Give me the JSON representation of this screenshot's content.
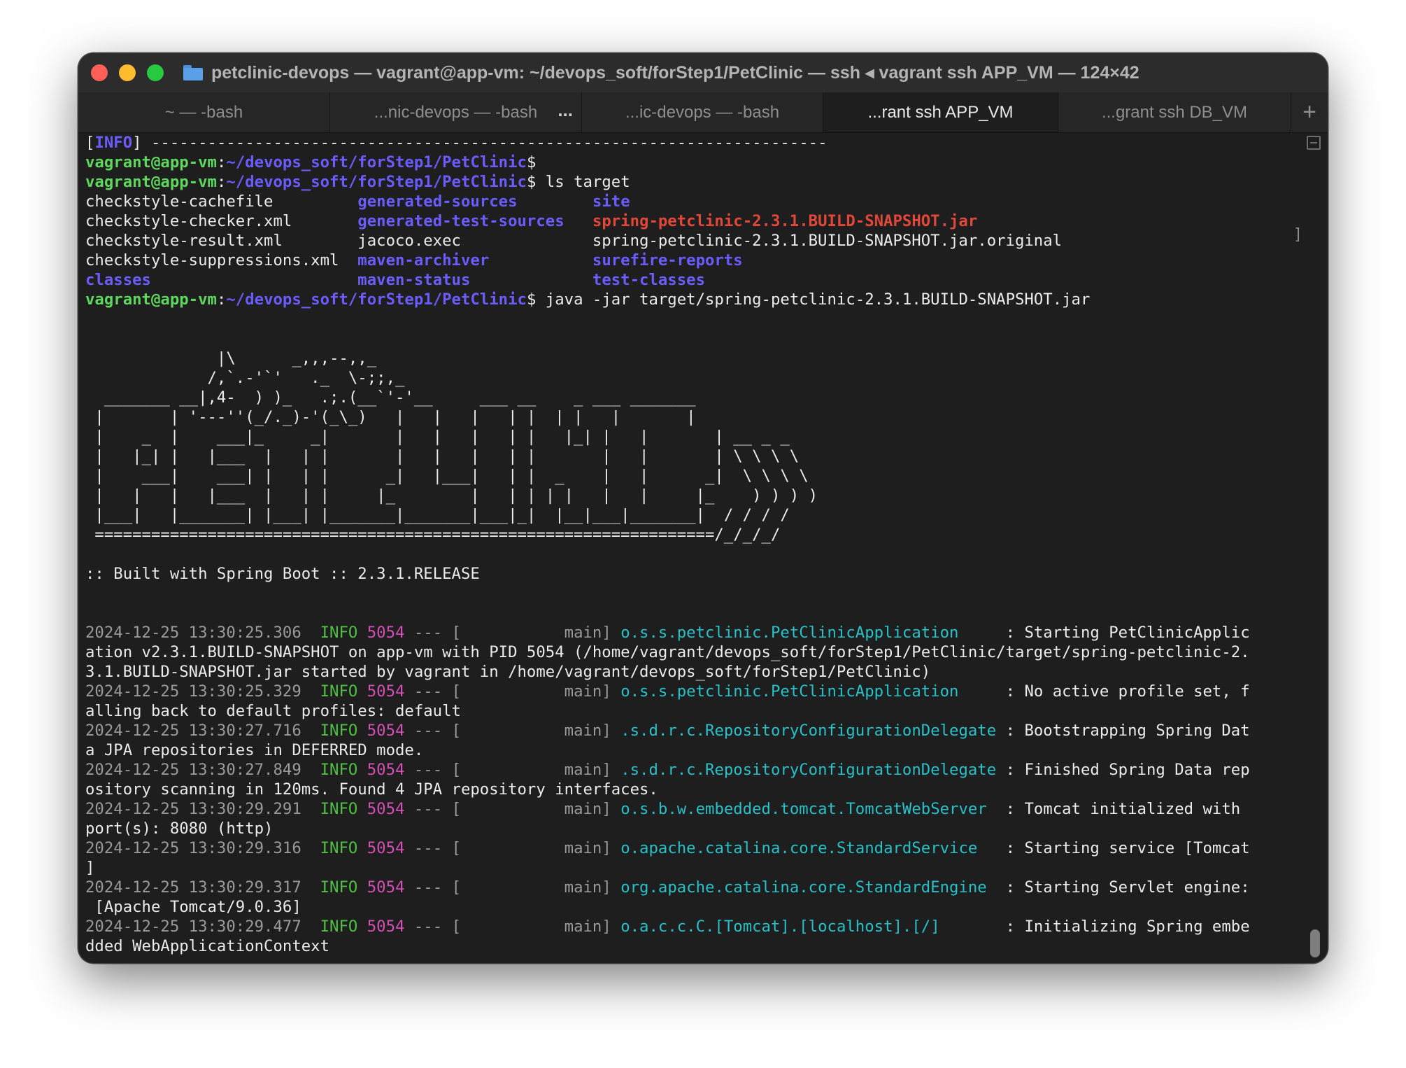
{
  "window": {
    "title": "petclinic-devops — vagrant@app-vm: ~/devops_soft/forStep1/PetClinic — ssh ◂ vagrant ssh APP_VM — 124×42",
    "folder_icon": "folder-icon"
  },
  "tabs": [
    {
      "label": "~ — -bash",
      "active": false,
      "width": 360
    },
    {
      "label": "...nic-devops — -bash",
      "active": false,
      "width": 360,
      "dots": "..."
    },
    {
      "label": "...ic-devops — -bash",
      "active": false,
      "width": 345
    },
    {
      "label": "...rant ssh APP_VM",
      "active": true,
      "width": 336
    },
    {
      "label": "...grant ssh DB_VM",
      "active": false,
      "width": 333
    }
  ],
  "new_tab_label": "+",
  "colors": {
    "prompt_user": "#5fd75f",
    "prompt_path": "#6a5cff",
    "directory": "#6a5cff",
    "archive": "#e2483a",
    "log_info": "#4fbf43",
    "log_pid": "#d44fb6",
    "log_logger": "#27c1c9",
    "log_timestamp": "#9a9a9a"
  },
  "terminal": {
    "lines": [
      [
        {
          "t": "[",
          "c": "white"
        },
        {
          "t": "INFO",
          "c": "purple"
        },
        {
          "t": "] ------------------------------------------------------------------------",
          "c": "white"
        }
      ],
      [
        {
          "t": "vagrant@app-vm",
          "c": "green"
        },
        {
          "t": ":",
          "c": "white"
        },
        {
          "t": "~/devops_soft/forStep1/PetClinic",
          "c": "purple"
        },
        {
          "t": "$",
          "c": "white"
        }
      ],
      [
        {
          "t": "vagrant@app-vm",
          "c": "green"
        },
        {
          "t": ":",
          "c": "white"
        },
        {
          "t": "~/devops_soft/forStep1/PetClinic",
          "c": "purple"
        },
        {
          "t": "$ ls target",
          "c": "white"
        }
      ],
      [
        {
          "t": "checkstyle-cachefile         ",
          "c": "white"
        },
        {
          "t": "generated-sources",
          "c": "purple"
        },
        {
          "t": "        ",
          "c": "white"
        },
        {
          "t": "site",
          "c": "purple"
        }
      ],
      [
        {
          "t": "checkstyle-checker.xml       ",
          "c": "white"
        },
        {
          "t": "generated-test-sources",
          "c": "purple"
        },
        {
          "t": "   ",
          "c": "white"
        },
        {
          "t": "spring-petclinic-2.3.1.BUILD-SNAPSHOT.jar",
          "c": "red"
        }
      ],
      [
        {
          "t": "checkstyle-result.xml        jacoco.exec              spring-petclinic-2.3.1.BUILD-SNAPSHOT.jar.original",
          "c": "white"
        }
      ],
      [
        {
          "t": "checkstyle-suppressions.xml  ",
          "c": "white"
        },
        {
          "t": "maven-archiver",
          "c": "purple"
        },
        {
          "t": "           ",
          "c": "white"
        },
        {
          "t": "surefire-reports",
          "c": "purple"
        }
      ],
      [
        {
          "t": "classes",
          "c": "purple"
        },
        {
          "t": "                      ",
          "c": "white"
        },
        {
          "t": "maven-status",
          "c": "purple"
        },
        {
          "t": "             ",
          "c": "white"
        },
        {
          "t": "test-classes",
          "c": "purple"
        }
      ],
      [
        {
          "t": "vagrant@app-vm",
          "c": "green"
        },
        {
          "t": ":",
          "c": "white"
        },
        {
          "t": "~/devops_soft/forStep1/PetClinic",
          "c": "purple"
        },
        {
          "t": "$ java -jar target/spring-petclinic-2.3.1.BUILD-SNAPSHOT.jar",
          "c": "white"
        }
      ],
      [
        {
          "t": "",
          "c": "white"
        }
      ],
      [
        {
          "t": "",
          "c": "white"
        }
      ],
      [
        {
          "t": "              |\\      _,,,--,,_",
          "c": "white"
        }
      ],
      [
        {
          "t": "             /,`.-'`'   ._  \\-;;,_",
          "c": "white"
        }
      ],
      [
        {
          "t": "  _______ __|,4-  ) )_   .;.(__`'-'__     ___ __    _ ___ _______",
          "c": "white"
        }
      ],
      [
        {
          "t": " |       | '---''(_/._)-'(_\\_)   |   |   |   | |  | |   |       |",
          "c": "white"
        }
      ],
      [
        {
          "t": " |    _  |    ___|_     _|       |   |   |   | |   |_| |   |       | __ _ _",
          "c": "white"
        }
      ],
      [
        {
          "t": " |   |_| |   |___  |   | |       |   |   |   | |       |   |       | \\ \\ \\ \\",
          "c": "white"
        }
      ],
      [
        {
          "t": " |    ___|    ___| |   | |      _|   |___|   | |  _    |   |      _|  \\ \\ \\ \\",
          "c": "white"
        }
      ],
      [
        {
          "t": " |   |   |   |___  |   | |     |_        |   | | | |   |   |     |_    ) ) ) )",
          "c": "white"
        }
      ],
      [
        {
          "t": " |___|   |_______| |___| |_______|_______|___|_|  |__|___|_______|  / / / /",
          "c": "white"
        }
      ],
      [
        {
          "t": " ==================================================================/_/_/_/",
          "c": "white"
        }
      ],
      [
        {
          "t": "",
          "c": "white"
        }
      ],
      [
        {
          "t": ":: Built with Spring Boot :: 2.3.1.RELEASE",
          "c": "white"
        }
      ],
      [
        {
          "t": "",
          "c": "white"
        }
      ],
      [
        {
          "t": "",
          "c": "white"
        }
      ],
      [
        {
          "t": "2024-12-25 13:30:25.306  ",
          "c": "gray"
        },
        {
          "t": "INFO",
          "c": "info"
        },
        {
          "t": " ",
          "c": "white"
        },
        {
          "t": "5054",
          "c": "pid"
        },
        {
          "t": " --- [           main] ",
          "c": "gray"
        },
        {
          "t": "o.s.s.petclinic.PetClinicApplication    ",
          "c": "cyan"
        },
        {
          "t": " : Starting PetClinicApplic",
          "c": "white"
        }
      ],
      [
        {
          "t": "ation v2.3.1.BUILD-SNAPSHOT on app-vm with PID 5054 (/home/vagrant/devops_soft/forStep1/PetClinic/target/spring-petclinic-2.",
          "c": "white"
        }
      ],
      [
        {
          "t": "3.1.BUILD-SNAPSHOT.jar started by vagrant in /home/vagrant/devops_soft/forStep1/PetClinic)",
          "c": "white"
        }
      ],
      [
        {
          "t": "2024-12-25 13:30:25.329  ",
          "c": "gray"
        },
        {
          "t": "INFO",
          "c": "info"
        },
        {
          "t": " ",
          "c": "white"
        },
        {
          "t": "5054",
          "c": "pid"
        },
        {
          "t": " --- [           main] ",
          "c": "gray"
        },
        {
          "t": "o.s.s.petclinic.PetClinicApplication    ",
          "c": "cyan"
        },
        {
          "t": " : No active profile set, f",
          "c": "white"
        }
      ],
      [
        {
          "t": "alling back to default profiles: default",
          "c": "white"
        }
      ],
      [
        {
          "t": "2024-12-25 13:30:27.716  ",
          "c": "gray"
        },
        {
          "t": "INFO",
          "c": "info"
        },
        {
          "t": " ",
          "c": "white"
        },
        {
          "t": "5054",
          "c": "pid"
        },
        {
          "t": " --- [           main] ",
          "c": "gray"
        },
        {
          "t": ".s.d.r.c.RepositoryConfigurationDelegate",
          "c": "cyan"
        },
        {
          "t": " : Bootstrapping Spring Dat",
          "c": "white"
        }
      ],
      [
        {
          "t": "a JPA repositories in DEFERRED mode.",
          "c": "white"
        }
      ],
      [
        {
          "t": "2024-12-25 13:30:27.849  ",
          "c": "gray"
        },
        {
          "t": "INFO",
          "c": "info"
        },
        {
          "t": " ",
          "c": "white"
        },
        {
          "t": "5054",
          "c": "pid"
        },
        {
          "t": " --- [           main] ",
          "c": "gray"
        },
        {
          "t": ".s.d.r.c.RepositoryConfigurationDelegate",
          "c": "cyan"
        },
        {
          "t": " : Finished Spring Data rep",
          "c": "white"
        }
      ],
      [
        {
          "t": "ository scanning in 120ms. Found 4 JPA repository interfaces.",
          "c": "white"
        }
      ],
      [
        {
          "t": "2024-12-25 13:30:29.291  ",
          "c": "gray"
        },
        {
          "t": "INFO",
          "c": "info"
        },
        {
          "t": " ",
          "c": "white"
        },
        {
          "t": "5054",
          "c": "pid"
        },
        {
          "t": " --- [           main] ",
          "c": "gray"
        },
        {
          "t": "o.s.b.w.embedded.tomcat.TomcatWebServer ",
          "c": "cyan"
        },
        {
          "t": " : Tomcat initialized with",
          "c": "white"
        }
      ],
      [
        {
          "t": "port(s): 8080 (http)",
          "c": "white"
        }
      ],
      [
        {
          "t": "2024-12-25 13:30:29.316  ",
          "c": "gray"
        },
        {
          "t": "INFO",
          "c": "info"
        },
        {
          "t": " ",
          "c": "white"
        },
        {
          "t": "5054",
          "c": "pid"
        },
        {
          "t": " --- [           main] ",
          "c": "gray"
        },
        {
          "t": "o.apache.catalina.core.StandardService  ",
          "c": "cyan"
        },
        {
          "t": " : Starting service [Tomcat",
          "c": "white"
        }
      ],
      [
        {
          "t": "]",
          "c": "white"
        }
      ],
      [
        {
          "t": "2024-12-25 13:30:29.317  ",
          "c": "gray"
        },
        {
          "t": "INFO",
          "c": "info"
        },
        {
          "t": " ",
          "c": "white"
        },
        {
          "t": "5054",
          "c": "pid"
        },
        {
          "t": " --- [           main] ",
          "c": "gray"
        },
        {
          "t": "org.apache.catalina.core.StandardEngine ",
          "c": "cyan"
        },
        {
          "t": " : Starting Servlet engine:",
          "c": "white"
        }
      ],
      [
        {
          "t": " [Apache Tomcat/9.0.36]",
          "c": "white"
        }
      ],
      [
        {
          "t": "2024-12-25 13:30:29.477  ",
          "c": "gray"
        },
        {
          "t": "INFO",
          "c": "info"
        },
        {
          "t": " ",
          "c": "white"
        },
        {
          "t": "5054",
          "c": "pid"
        },
        {
          "t": " --- [           main] ",
          "c": "gray"
        },
        {
          "t": "o.a.c.c.C.[Tomcat].[localhost].[/]      ",
          "c": "cyan"
        },
        {
          "t": " : Initializing Spring embe",
          "c": "white"
        }
      ],
      [
        {
          "t": "dded WebApplicationContext",
          "c": "white"
        }
      ]
    ]
  }
}
